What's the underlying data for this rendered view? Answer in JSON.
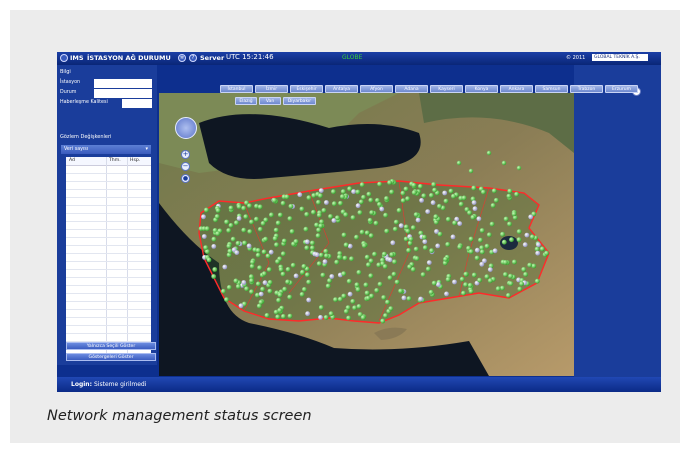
{
  "app": {
    "logo_text": "IMS",
    "title": "İSTASYON AĞ DURUMU",
    "server_label": "Server",
    "utc_time": "UTC 15:21:46",
    "center_text": "GLOBE",
    "copyright": "© 2011",
    "brand": "GLOBAL TEKNİK A.Ş."
  },
  "left_panel": {
    "info_header": "Bilgi",
    "fields": [
      {
        "label": "İstasyon",
        "value": ""
      },
      {
        "label": "Durum",
        "value": ""
      },
      {
        "label": "Haberleşme Kalitesi",
        "value": ""
      }
    ],
    "view_header": "Gözlem Değişkenleri",
    "dropdown_value": "Veri sayısı",
    "table_headers": [
      "Ad",
      "Thm.",
      "Hsp."
    ],
    "button_show_selected": "Yalnızca Seçili Göster",
    "button_show_all": "Göstergeleri Göster"
  },
  "city_buttons_row1": [
    "İstanbul",
    "İzmir",
    "Eskişehir",
    "Antalya",
    "Afyon",
    "Adana",
    "Kayseri",
    "Konya",
    "Ankara",
    "Samsun",
    "Trabzon",
    "Erzurum"
  ],
  "city_buttons_row2": [
    "Elazığ",
    "Van",
    "Diyarbakır"
  ],
  "status": {
    "login_label": "Login:",
    "login_value": "Sisteme girilmedi"
  },
  "caption": "Network management status screen",
  "icons": [
    "window-icon",
    "gear-icon",
    "help-icon",
    "close-icon",
    "pan-control-icon",
    "zoom-in-icon",
    "zoom-out-icon",
    "person-icon"
  ],
  "colors": {
    "panel": "#1a3d9b",
    "station_ok": "#5fd14a",
    "station_other": "#a9a9d6",
    "border": "#ff2a2a"
  }
}
